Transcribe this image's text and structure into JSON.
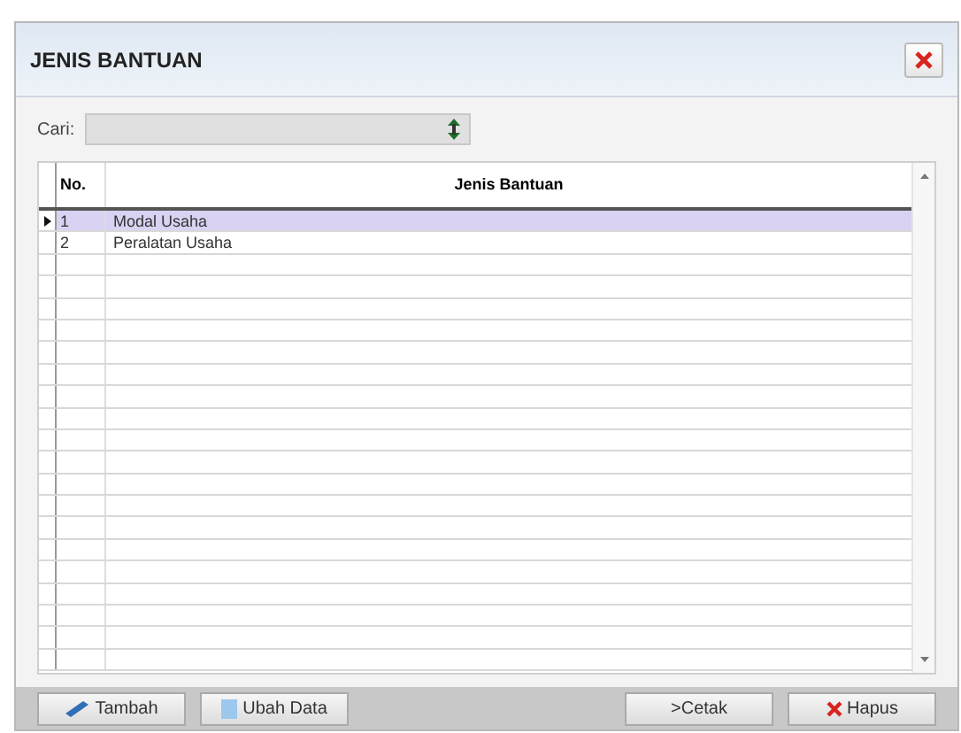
{
  "window": {
    "title": "JENIS BANTUAN"
  },
  "search": {
    "label": "Cari:"
  },
  "table": {
    "columns": [
      "No.",
      "Jenis Bantuan"
    ],
    "rows": [
      {
        "no": "1",
        "name": "Modal Usaha",
        "selected": true
      },
      {
        "no": "2",
        "name": "Peralatan Usaha",
        "selected": false
      }
    ]
  },
  "buttons": [
    {
      "kind": "add",
      "label": "Tambah"
    },
    {
      "kind": "edit",
      "label": "Ubah Data"
    },
    {
      "kind": "print",
      "label": ">Cetak"
    },
    {
      "kind": "delete",
      "label": "Hapus"
    }
  ]
}
